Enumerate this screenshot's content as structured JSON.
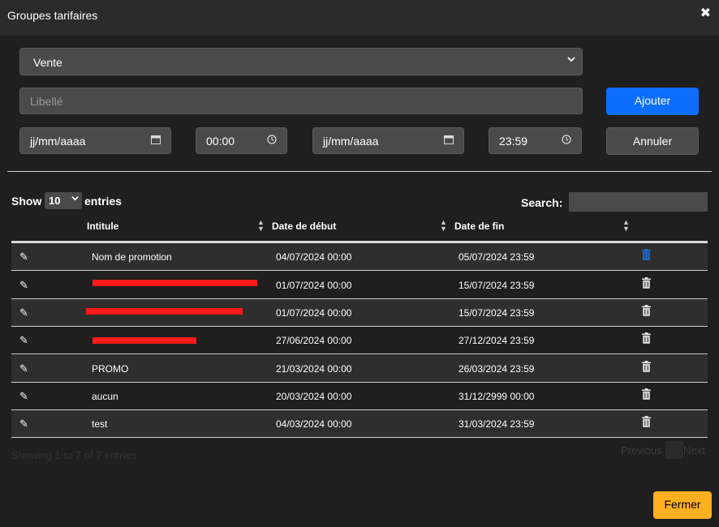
{
  "dialog": {
    "title": "Groupes tarifaires"
  },
  "form": {
    "type_value": "Vente",
    "libelle_placeholder": "Libellé",
    "date_start": "jj/mm/aaaa",
    "time_start": "00:00",
    "date_end": "jj/mm/aaaa",
    "time_end": "23:59",
    "add_label": "Ajouter",
    "cancel_label": "Annuler"
  },
  "table_controls": {
    "show_label": "Show",
    "page_size": "10",
    "entries_label": "entries",
    "search_label": "Search:"
  },
  "columns": [
    "Intitule",
    "Date de début",
    "Date de fin"
  ],
  "rows": [
    {
      "intitule": "Nom de promotion",
      "debut": "04/07/2024 00:00",
      "fin": "05/07/2024 23:59"
    },
    {
      "intitule": "",
      "debut": "01/07/2024 00:00",
      "fin": "15/07/2024 23:59"
    },
    {
      "intitule": "",
      "debut": "01/07/2024 00:00",
      "fin": "15/07/2024 23:59"
    },
    {
      "intitule": "",
      "debut": "27/06/2024 00:00",
      "fin": "27/12/2024 23:59"
    },
    {
      "intitule": "PROMO",
      "debut": "21/03/2024 00:00",
      "fin": "26/03/2024 23:59"
    },
    {
      "intitule": "aucun",
      "debut": "20/03/2024 00:00",
      "fin": "31/12/2999 00:00"
    },
    {
      "intitule": "test",
      "debut": "04/03/2024 00:00",
      "fin": "31/03/2024 23:59"
    }
  ],
  "pagination": {
    "info": "Showing 1 to 7 of 7 entries",
    "previous": "Previous",
    "next": "Next"
  },
  "footer": {
    "close_label": "Fermer"
  },
  "colors": {
    "primary": "#0d6efd",
    "warning": "#ffb020",
    "trash_active": "#1e6fd9",
    "redaction": "#ff1a1a"
  }
}
